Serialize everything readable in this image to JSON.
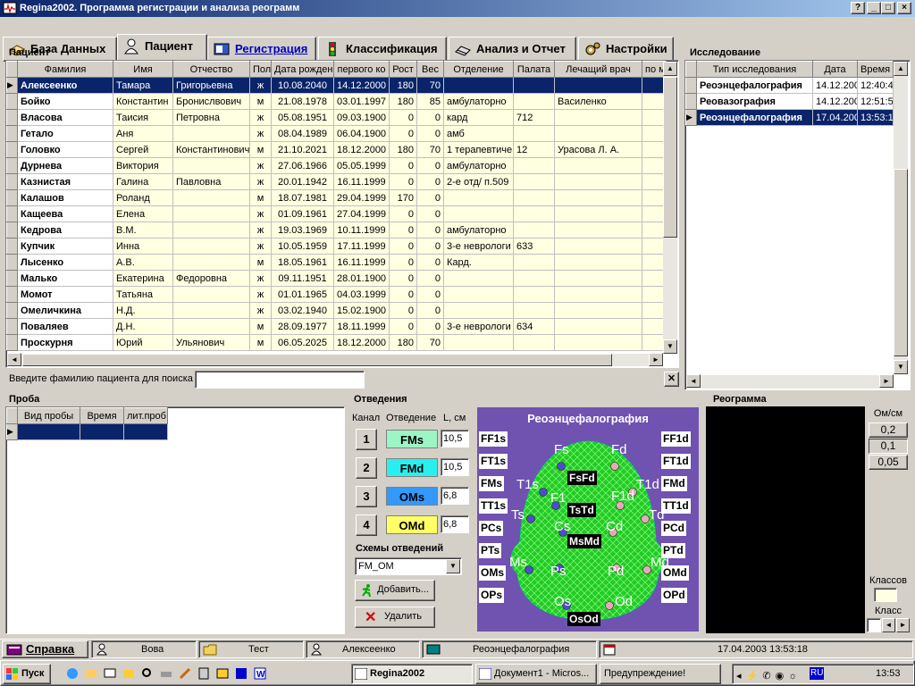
{
  "window": {
    "title": "Regina2002. Программа регистрации и анализа реограмм",
    "btn_help": "?",
    "btn_min": "_",
    "btn_max": "□",
    "btn_close": "×"
  },
  "tabs": [
    {
      "label": "База Данных",
      "icon": "database-book-icon"
    },
    {
      "label": "Пациент",
      "icon": "patient-icon"
    },
    {
      "label": "Регистрация",
      "icon": "registration-icon"
    },
    {
      "label": "Классификация",
      "icon": "traffic-light-icon"
    },
    {
      "label": "Анализ и Отчет",
      "icon": "report-icon"
    },
    {
      "label": "Настройки",
      "icon": "settings-icon"
    }
  ],
  "patient": {
    "label": "Пациент",
    "columns": [
      "Фамилия",
      "Имя",
      "Отчество",
      "Пол",
      "Дата рождени",
      "первого ко",
      "Рост",
      "Вес",
      "Отделение",
      "Палата",
      "Лечащий врач",
      "по м"
    ],
    "rows": [
      [
        "Алексеенко",
        "Тамара",
        "Григорьевна",
        "ж",
        "10.08.2040",
        "14.12.2000",
        "180",
        "70",
        "",
        "",
        "",
        ""
      ],
      [
        "Бойко",
        "Константин",
        "Бронислвович",
        "м",
        "21.08.1978",
        "03.01.1997",
        "180",
        "85",
        "амбулаторно",
        "",
        "Василенко",
        ""
      ],
      [
        "Власова",
        "Таисия",
        "Петровна",
        "ж",
        "05.08.1951",
        "09.03.1900",
        "0",
        "0",
        "кард",
        "712",
        "",
        ""
      ],
      [
        "Гетало",
        "Аня",
        "",
        "ж",
        "08.04.1989",
        "06.04.1900",
        "0",
        "0",
        "амб",
        "",
        "",
        ""
      ],
      [
        "Головко",
        "Сергей",
        "Константинович",
        "м",
        "21.10.2021",
        "18.12.2000",
        "180",
        "70",
        "1 терапевтиче",
        "12",
        "Урасова Л. А.",
        ""
      ],
      [
        "Дурнева",
        "Виктория",
        "",
        "ж",
        "27.06.1966",
        "05.05.1999",
        "0",
        "0",
        "амбулаторно",
        "",
        "",
        ""
      ],
      [
        "Казнистая",
        "Галина",
        "Павловна",
        "ж",
        "20.01.1942",
        "16.11.1999",
        "0",
        "0",
        "2-е отд/ п.509",
        "",
        "",
        ""
      ],
      [
        "Калашов",
        "Роланд",
        "",
        "м",
        "18.07.1981",
        "29.04.1999",
        "170",
        "0",
        "",
        "",
        "",
        ""
      ],
      [
        "Кащеева",
        "Елена",
        "",
        "ж",
        "01.09.1961",
        "27.04.1999",
        "0",
        "0",
        "",
        "",
        "",
        ""
      ],
      [
        "Кедрова",
        "В.М.",
        "",
        "ж",
        "19.03.1969",
        "10.11.1999",
        "0",
        "0",
        "амбулаторно",
        "",
        "",
        ""
      ],
      [
        "Купчик",
        "Инна",
        "",
        "ж",
        "10.05.1959",
        "17.11.1999",
        "0",
        "0",
        "3-е неврологи",
        "633",
        "",
        ""
      ],
      [
        "Лысенко",
        "А.В.",
        "",
        "м",
        "18.05.1961",
        "16.11.1999",
        "0",
        "0",
        "Кард.",
        "",
        "",
        ""
      ],
      [
        "Малько",
        "Екатерина",
        "Федоровна",
        "ж",
        "09.11.1951",
        "28.01.1900",
        "0",
        "0",
        "",
        "",
        "",
        ""
      ],
      [
        "Момот",
        "Татьяна",
        "",
        "ж",
        "01.01.1965",
        "04.03.1999",
        "0",
        "0",
        "",
        "",
        "",
        ""
      ],
      [
        "Омеличкина",
        "Н.Д.",
        "",
        "ж",
        "03.02.1940",
        "15.02.1900",
        "0",
        "0",
        "",
        "",
        "",
        ""
      ],
      [
        "Поваляев",
        "Д.Н.",
        "",
        "м",
        "28.09.1977",
        "18.11.1999",
        "0",
        "0",
        "3-е неврологи",
        "634",
        "",
        ""
      ],
      [
        "Проскурня",
        "Юрий",
        "Ульянович",
        "м",
        "06.05.2025",
        "18.12.2000",
        "180",
        "70",
        "",
        "",
        "",
        ""
      ]
    ],
    "search_label": "Введите фамилию пациента для поиска",
    "search_value": ""
  },
  "study": {
    "label": "Исследование",
    "columns": [
      "Тип исследования",
      "Дата",
      "Время"
    ],
    "rows": [
      [
        "Реоэнцефалография",
        "14.12.2000",
        "12:40:4"
      ],
      [
        "Реовазография",
        "14.12.2000",
        "12:51:5"
      ],
      [
        "Реоэнцефалография",
        "17.04.2003",
        "13:53:1"
      ]
    ]
  },
  "probe": {
    "label": "Проба",
    "columns": [
      "Вид пробы",
      "Время",
      "лит.проб"
    ]
  },
  "leads": {
    "label": "Отведения",
    "col_channel": "Канал",
    "col_lead": "Отведение",
    "col_l": "L, см",
    "channels": [
      {
        "num": "1",
        "name": "FMs",
        "l": "10,5",
        "color": "#9bf5c4"
      },
      {
        "num": "2",
        "name": "FMd",
        "l": "10,5",
        "color": "#28f0ee"
      },
      {
        "num": "3",
        "name": "OMs",
        "l": "6,8",
        "color": "#3399ff"
      },
      {
        "num": "4",
        "name": "OMd",
        "l": "6,8",
        "color": "#ffff66"
      }
    ],
    "schemes_label": "Схемы отведений",
    "scheme_value": "FM_OM",
    "add_label": "Добавить...",
    "delete_label": "Удалить"
  },
  "head": {
    "title": "Реоэнцефалография",
    "left_labels": [
      "FF1s",
      "FT1s",
      "FMs",
      "TT1s",
      "PCs",
      "PTs",
      "OMs",
      "OPs"
    ],
    "right_labels": [
      "FF1d",
      "FT1d",
      "FMd",
      "TT1d",
      "PCd",
      "PTd",
      "OMd",
      "OPd"
    ],
    "center_labels": [
      "FsFd",
      "TsTd",
      "MsMd",
      "OsOd"
    ],
    "electrodes": [
      "Fs",
      "Fd",
      "T1s",
      "T1d",
      "Ts",
      "Td",
      "F1",
      "F1d",
      "Cs",
      "Cd",
      "Ms",
      "Md",
      "Ps",
      "Pd",
      "Os",
      "Od"
    ],
    "bg_color": "#7052b0",
    "head_color": "#22cc22"
  },
  "reogram": {
    "label": "Реограмма",
    "omcm_label": "Ом/см",
    "scales": [
      "0,2",
      "0,1",
      "0,05"
    ],
    "selected_scale": "0,1",
    "classes_label": "Классов",
    "class_label": "Класс"
  },
  "statusbar": {
    "help_label": "Справка",
    "user": "Вова",
    "folder": "Тест",
    "patient": "Алексеенко",
    "study": "Реоэнцефалография",
    "datetime": "17.04.2003 13:53:18"
  },
  "taskbar": {
    "start_label": "Пуск",
    "items": [
      "Regina2002",
      "Документ1 - Micros...",
      "Предупреждение!"
    ],
    "lang": "RU",
    "clock": "13:53"
  }
}
